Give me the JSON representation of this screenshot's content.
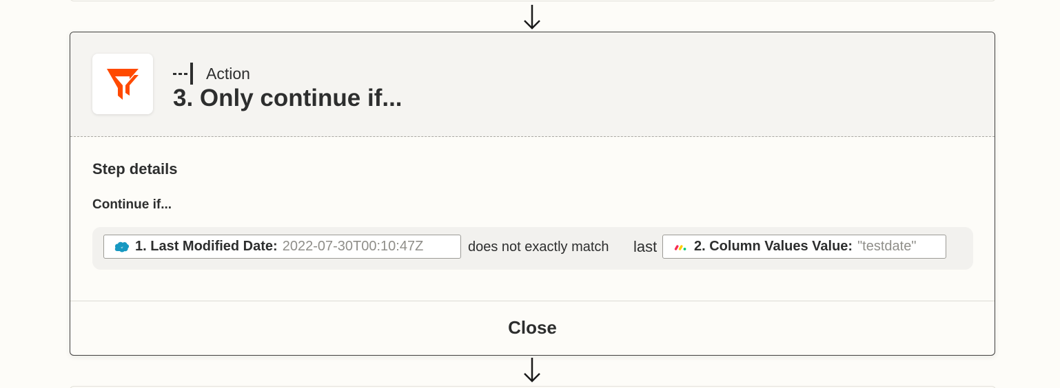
{
  "step": {
    "type_label": "Action",
    "title": "3. Only continue if..."
  },
  "details": {
    "section_title": "Step details",
    "condition_label": "Continue if..."
  },
  "rule": {
    "left_field": {
      "icon": "salesforce-icon",
      "label": "1. Last Modified Date:",
      "value": "2022-07-30T00:10:47Z"
    },
    "operator": "does not exactly match",
    "literal": "last",
    "right_field": {
      "icon": "monday-icon",
      "label": "2. Column Values Value:",
      "value": "\"testdate\""
    }
  },
  "footer": {
    "close_label": "Close"
  },
  "colors": {
    "filter_orange": "#ff4a00",
    "salesforce_blue": "#1798c1"
  }
}
